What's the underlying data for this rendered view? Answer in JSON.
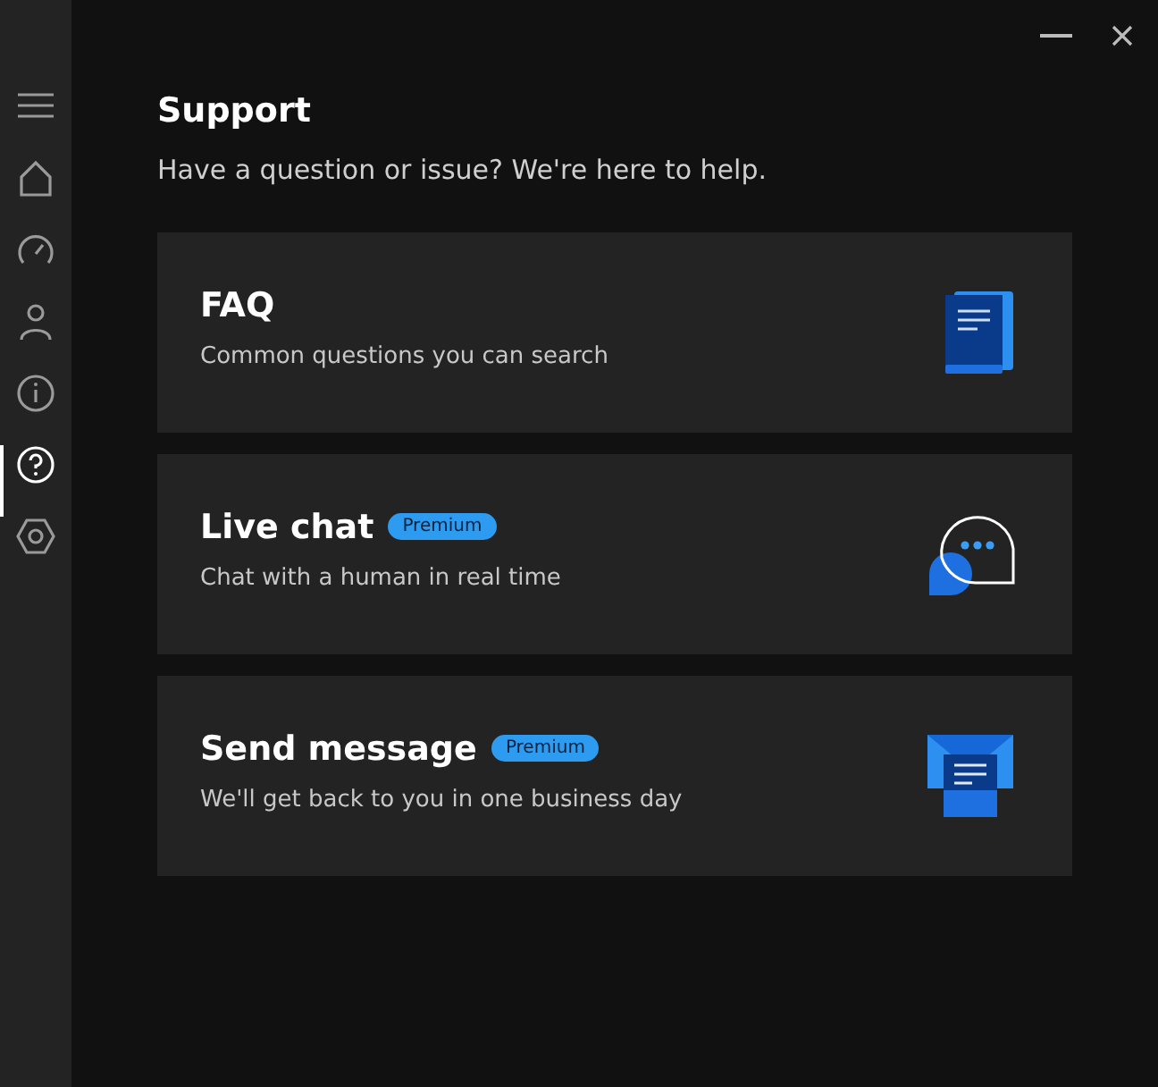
{
  "sidebar": {
    "items": [
      {
        "kind": "menu",
        "selected": false
      },
      {
        "kind": "home",
        "selected": false
      },
      {
        "kind": "speed",
        "selected": false
      },
      {
        "kind": "account",
        "selected": false
      },
      {
        "kind": "info",
        "selected": false
      },
      {
        "kind": "help",
        "selected": true
      },
      {
        "kind": "settings",
        "selected": false
      }
    ]
  },
  "page": {
    "title": "Support",
    "subtitle": "Have a question or issue? We're here to help."
  },
  "cards": [
    {
      "kind": "faq",
      "title": "FAQ",
      "description": "Common questions you can search"
    },
    {
      "kind": "chat",
      "title": "Live chat",
      "badge": "Premium",
      "description": "Chat with a human in real time"
    },
    {
      "kind": "message",
      "title": "Send message",
      "badge": "Premium",
      "description": "We'll get back to you in one business day"
    }
  ]
}
